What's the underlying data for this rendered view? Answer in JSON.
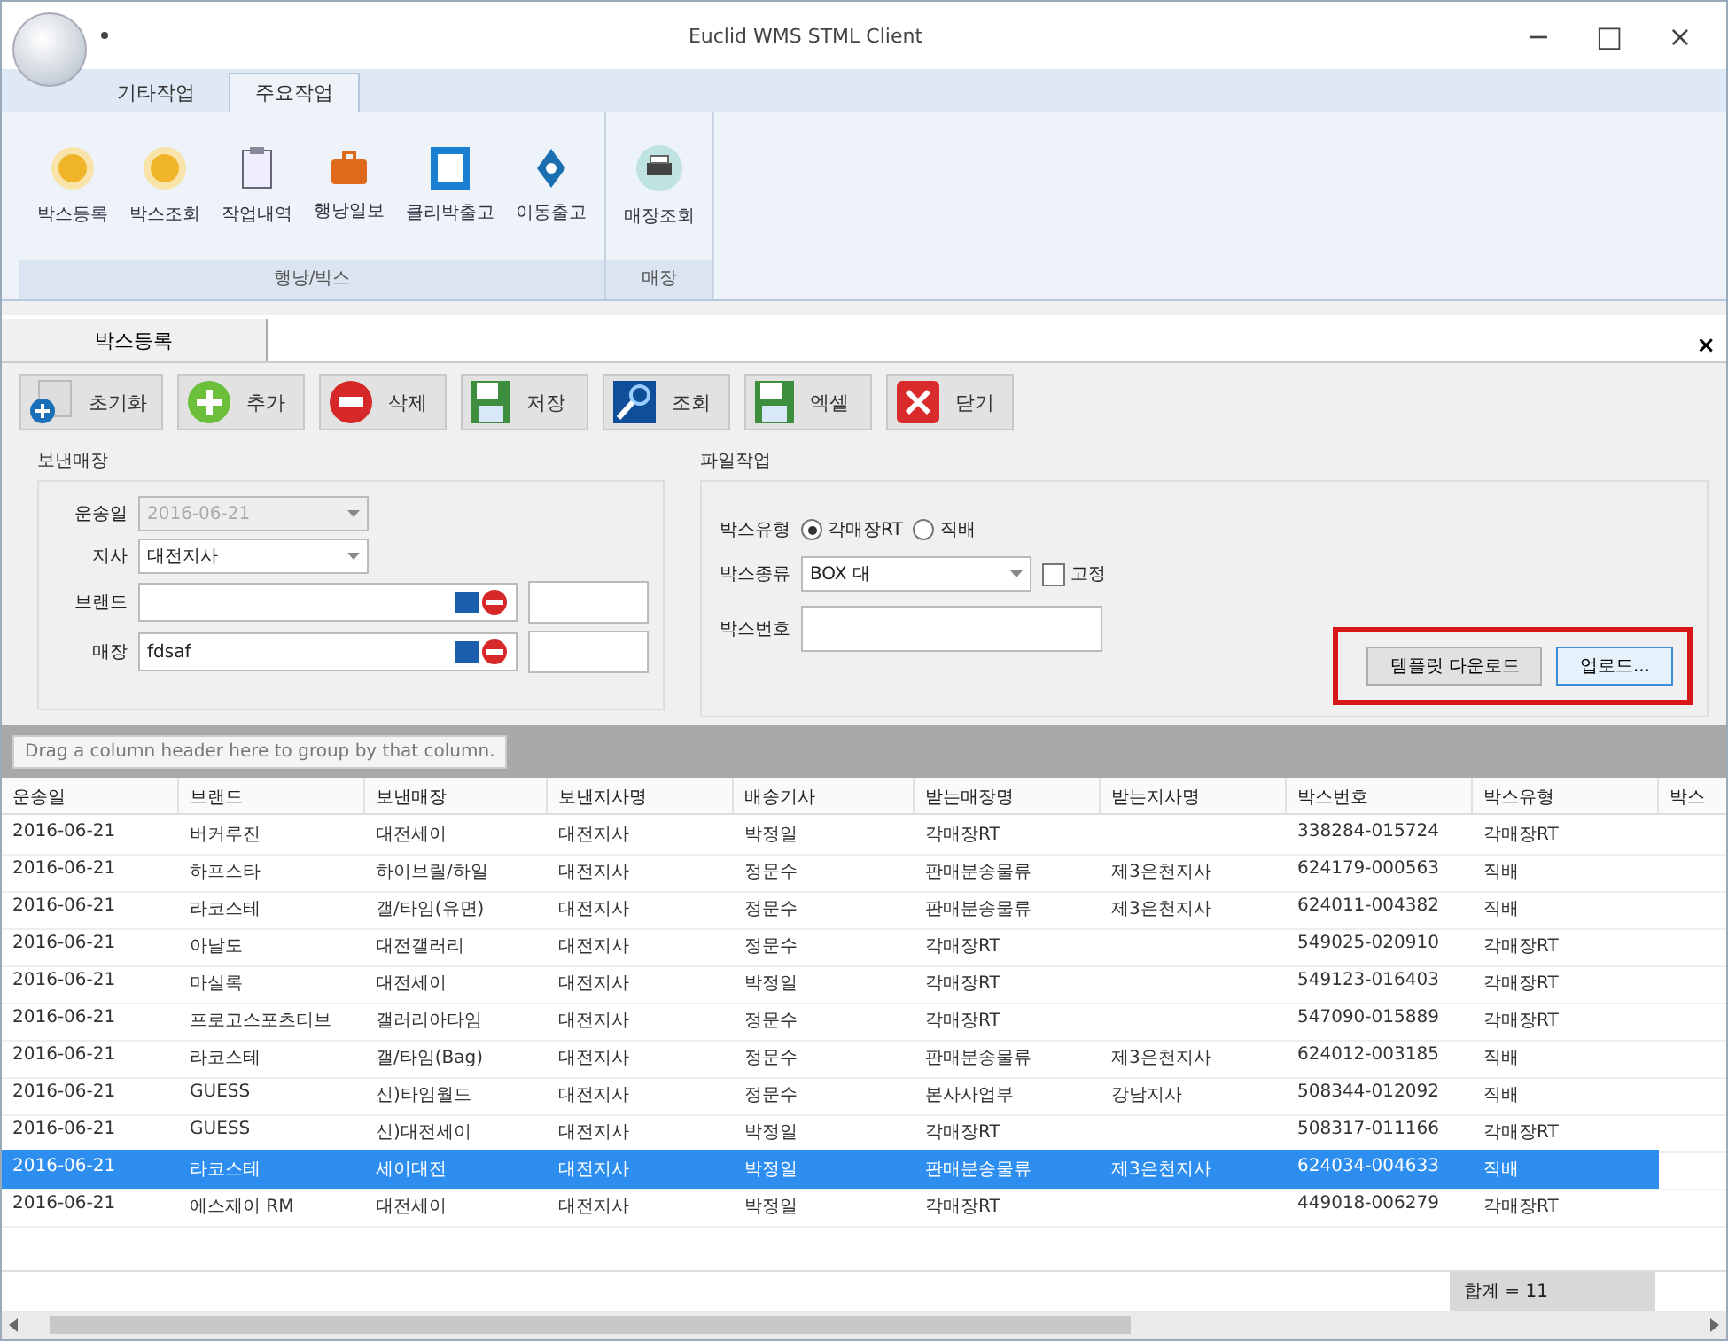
{
  "window": {
    "title": "Euclid WMS STML Client",
    "controls": [
      "−",
      "□",
      "×"
    ]
  },
  "ribbon": {
    "tabs": [
      {
        "label": "기타작업",
        "selected": false
      },
      {
        "label": "주요작업",
        "selected": true
      }
    ],
    "groups": [
      {
        "label": "행낭/박스",
        "buttons": [
          "박스등록",
          "박스조회",
          "작업내역",
          "행낭일보",
          "클리박출고",
          "이동출고"
        ]
      },
      {
        "label": "매장",
        "buttons": [
          "매장조회"
        ]
      }
    ]
  },
  "document_tabs": [
    {
      "label": "박스등록",
      "selected": true
    }
  ],
  "close_tab": "×",
  "toolbar": [
    "초기화",
    "추가",
    "삭제",
    "저장",
    "조회",
    "엑셀",
    "닫기"
  ],
  "sender": {
    "title": "보낸매장",
    "fields": [
      {
        "label": "운송일",
        "kind": "combo",
        "value": "2016-06-21",
        "disabled": true
      },
      {
        "label": "지사",
        "kind": "combo",
        "value": "대전지사",
        "disabled": false
      },
      {
        "label": "브랜드",
        "kind": "lookup"
      },
      {
        "label": "매장",
        "kind": "lookup",
        "value": "fdsaf"
      }
    ]
  },
  "file_work": {
    "title": "파일작업",
    "box_type_label": "박스유형",
    "box_types": [
      {
        "label": "각매장RT",
        "selected": true
      },
      {
        "label": "직배",
        "selected": false
      }
    ],
    "box_kind_label": "박스종류",
    "box_kind": "BOX 대",
    "fixed": {
      "label": "고정",
      "checked": false
    },
    "box_number_label": "박스번호",
    "buttons": [
      "템플릿 다운로드",
      "업로드..."
    ]
  },
  "group_hint": "Drag a column header here to group by that column.",
  "table": {
    "columns": [
      "운송일",
      "브랜드",
      "보낸매장",
      "보낸지사명",
      "배송기사",
      "받는매장명",
      "받는지사명",
      "박스번호",
      "박스유형",
      "박스"
    ],
    "rows": [
      {
        "cells": [
          "2016-06-21",
          "버커루진",
          "대전세이",
          "대전지사",
          "박정일",
          "각매장RT",
          "",
          "338284-015724",
          "각매장RT",
          ""
        ],
        "selected": false
      },
      {
        "cells": [
          "2016-06-21",
          "하프스타",
          "하이브릴/하일",
          "대전지사",
          "정문수",
          "판매분송물류",
          "제3은천지사",
          "624179-000563",
          "직배",
          ""
        ],
        "selected": false
      },
      {
        "cells": [
          "2016-06-21",
          "라코스테",
          "갤/타임(유면)",
          "대전지사",
          "정문수",
          "판매분송물류",
          "제3은천지사",
          "624011-004382",
          "직배",
          ""
        ],
        "selected": false
      },
      {
        "cells": [
          "2016-06-21",
          "아날도",
          "대전갤러리",
          "대전지사",
          "정문수",
          "각매장RT",
          "",
          "549025-020910",
          "각매장RT",
          ""
        ],
        "selected": false
      },
      {
        "cells": [
          "2016-06-21",
          "마실록",
          "대전세이",
          "대전지사",
          "박정일",
          "각매장RT",
          "",
          "549123-016403",
          "각매장RT",
          ""
        ],
        "selected": false
      },
      {
        "cells": [
          "2016-06-21",
          "프로고스포츠티브",
          "갤러리아타임",
          "대전지사",
          "정문수",
          "각매장RT",
          "",
          "547090-015889",
          "각매장RT",
          ""
        ],
        "selected": false
      },
      {
        "cells": [
          "2016-06-21",
          "라코스테",
          "갤/타임(Bag)",
          "대전지사",
          "정문수",
          "판매분송물류",
          "제3은천지사",
          "624012-003185",
          "직배",
          ""
        ],
        "selected": false
      },
      {
        "cells": [
          "2016-06-21",
          "GUESS",
          "신)타임월드",
          "대전지사",
          "정문수",
          "본사사업부",
          "강남지사",
          "508344-012092",
          "직배",
          ""
        ],
        "selected": false
      },
      {
        "cells": [
          "2016-06-21",
          "GUESS",
          "신)대전세이",
          "대전지사",
          "박정일",
          "각매장RT",
          "",
          "508317-011166",
          "각매장RT",
          ""
        ],
        "selected": false
      },
      {
        "cells": [
          "2016-06-21",
          "라코스테",
          "세이대전",
          "대전지사",
          "박정일",
          "판매분송물류",
          "제3은천지사",
          "624034-004633",
          "직배",
          ""
        ],
        "selected": true
      },
      {
        "cells": [
          "2016-06-21",
          "에스제이 RM",
          "대전세이",
          "대전지사",
          "박정일",
          "각매장RT",
          "",
          "449018-006279",
          "각매장RT",
          ""
        ],
        "selected": false
      }
    ],
    "summary": "합계 = 11"
  }
}
